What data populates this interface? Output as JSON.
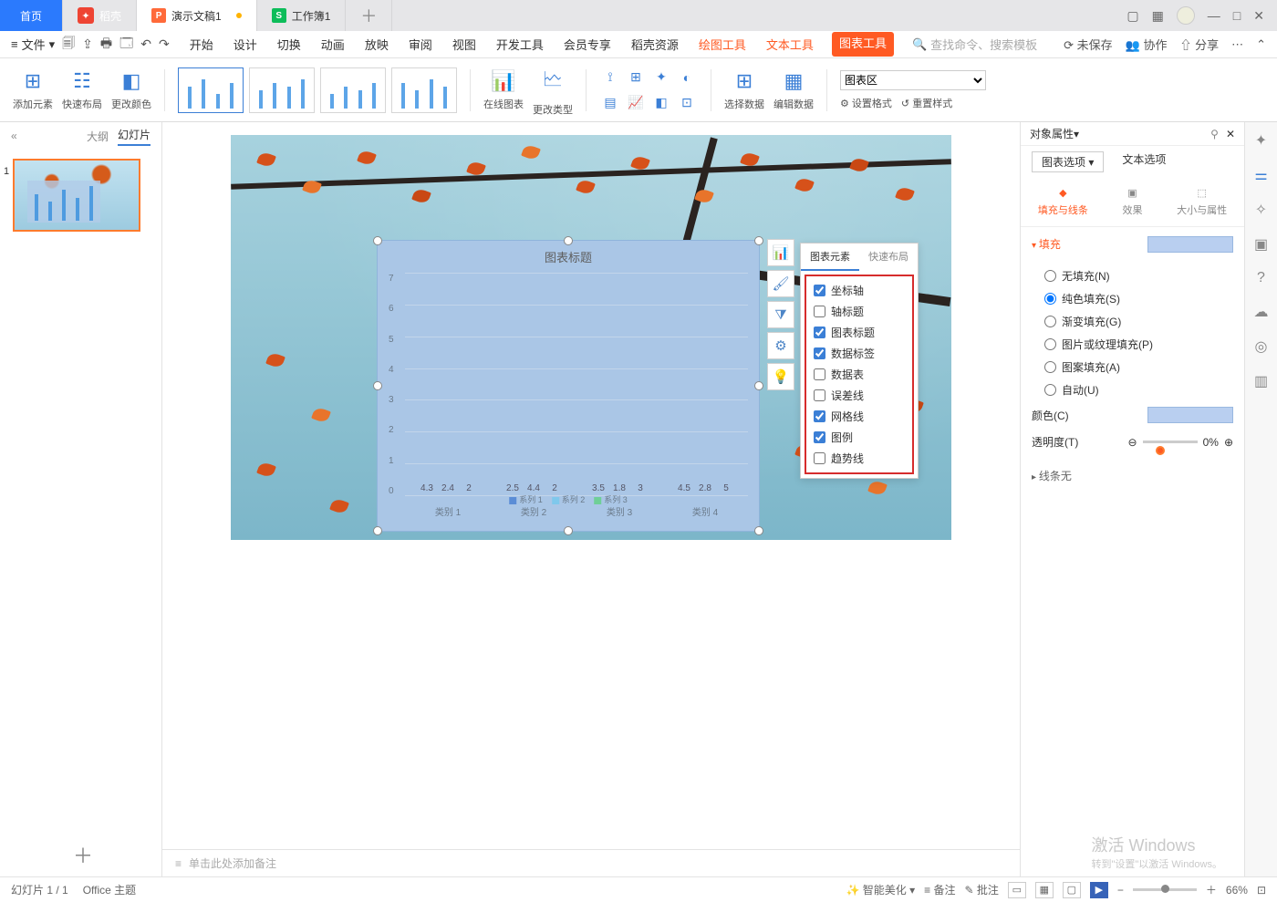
{
  "tabs": {
    "home": "首页",
    "doke": "稻壳",
    "doc1": "演示文稿1",
    "doc2": "工作簿1"
  },
  "menu": {
    "file": "文件",
    "items": [
      "开始",
      "设计",
      "切换",
      "动画",
      "放映",
      "审阅",
      "视图",
      "开发工具",
      "会员专享",
      "稻壳资源"
    ],
    "draw": "绘图工具",
    "text": "文本工具",
    "chart": "图表工具",
    "search_ph": "查找命令、搜索模板",
    "unsaved": "未保存",
    "collab": "协作",
    "share": "分享"
  },
  "ribbon": {
    "addElem": "添加元素",
    "quickLayout": "快速布局",
    "changeColor": "更改颜色",
    "onlineChart": "在线图表",
    "changeType": "更改类型",
    "selectData": "选择数据",
    "editData": "编辑数据",
    "chartArea": "图表区",
    "setFormat": "设置格式",
    "resetStyle": "重置样式"
  },
  "outline": {
    "tab1": "大纲",
    "tab2": "幻灯片",
    "num": "1"
  },
  "chart_data": {
    "type": "bar",
    "title": "图表标题",
    "categories": [
      "类别 1",
      "类别 2",
      "类别 3",
      "类别 4"
    ],
    "series": [
      {
        "name": "系列 1",
        "values": [
          4.3,
          2.5,
          3.5,
          4.5
        ]
      },
      {
        "name": "系列 2",
        "values": [
          2.4,
          4.4,
          1.8,
          2.8
        ]
      },
      {
        "name": "系列 3",
        "values": [
          2.0,
          2.0,
          3.0,
          5.0
        ]
      }
    ],
    "ylabel": "",
    "xlabel": "",
    "ylim": [
      0,
      7
    ],
    "yticks": [
      0,
      1,
      2,
      3,
      4,
      5,
      6,
      7
    ],
    "value_labels": {
      "c1": [
        "4.3",
        "2.4",
        "2"
      ],
      "c2": [
        "2.5",
        "4.4",
        "2"
      ],
      "c3": [
        "3.5",
        "1.8",
        "3"
      ],
      "c4": [
        "4.5",
        "2.8",
        "5"
      ]
    },
    "extra_label": "6",
    "legend": [
      "系列 1",
      "系列 2",
      "系列 3"
    ]
  },
  "popup": {
    "tab_elem": "图表元素",
    "tab_layout": "快速布局",
    "items": [
      {
        "label": "坐标轴",
        "checked": true
      },
      {
        "label": "轴标题",
        "checked": false
      },
      {
        "label": "图表标题",
        "checked": true
      },
      {
        "label": "数据标签",
        "checked": true
      },
      {
        "label": "数据表",
        "checked": false
      },
      {
        "label": "误差线",
        "checked": false
      },
      {
        "label": "网格线",
        "checked": true
      },
      {
        "label": "图例",
        "checked": true
      },
      {
        "label": "趋势线",
        "checked": false
      }
    ]
  },
  "panel": {
    "title": "对象属性",
    "opt_chart": "图表选项",
    "opt_text": "文本选项",
    "sub_fill": "填充与线条",
    "sub_fx": "效果",
    "sub_size": "大小与属性",
    "sect_fill": "填充",
    "fill_modes": [
      "无填充(N)",
      "纯色填充(S)",
      "渐变填充(G)",
      "图片或纹理填充(P)",
      "图案填充(A)",
      "自动(U)"
    ],
    "fill_selected": 1,
    "color_label": "颜色(C)",
    "opacity_label": "透明度(T)",
    "opacity_value": "0%",
    "sect_line": "线条",
    "line_value": "无"
  },
  "notes": "单击此处添加备注",
  "status": {
    "slide": "幻灯片 1 / 1",
    "theme": "Office 主题",
    "beautify": "智能美化",
    "notes": "备注",
    "comments": "批注",
    "zoom": "66%"
  },
  "watermark": {
    "title": "激活 Windows",
    "sub": "转到\"设置\"以激活 Windows。"
  }
}
